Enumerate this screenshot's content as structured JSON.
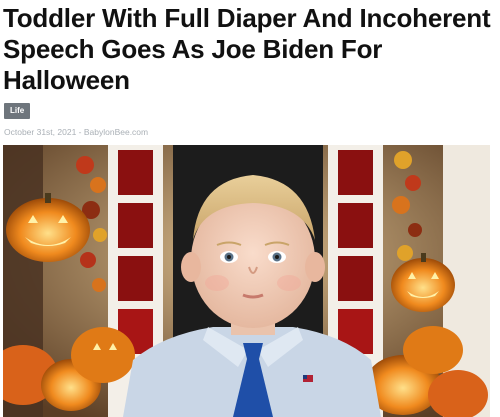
{
  "article": {
    "headline": "Toddler With Full Diaper And Incoherent Speech Goes As Joe Biden For Halloween",
    "category": "Life",
    "date": "October 31st, 2021",
    "separator": " - ",
    "source": "BabylonBee.com"
  },
  "hero_image": {
    "subject": "toddler in shirt and blue tie with pumpkins",
    "colors": {
      "shirt": "#c9d6e6",
      "tie": "#1f4fa8",
      "door": "#1c1c1c",
      "frame": "#f3efe8",
      "window_red": "#8a1010",
      "pumpkin": "#e07a16",
      "pumpkin_glow": "#ffd35a"
    }
  }
}
